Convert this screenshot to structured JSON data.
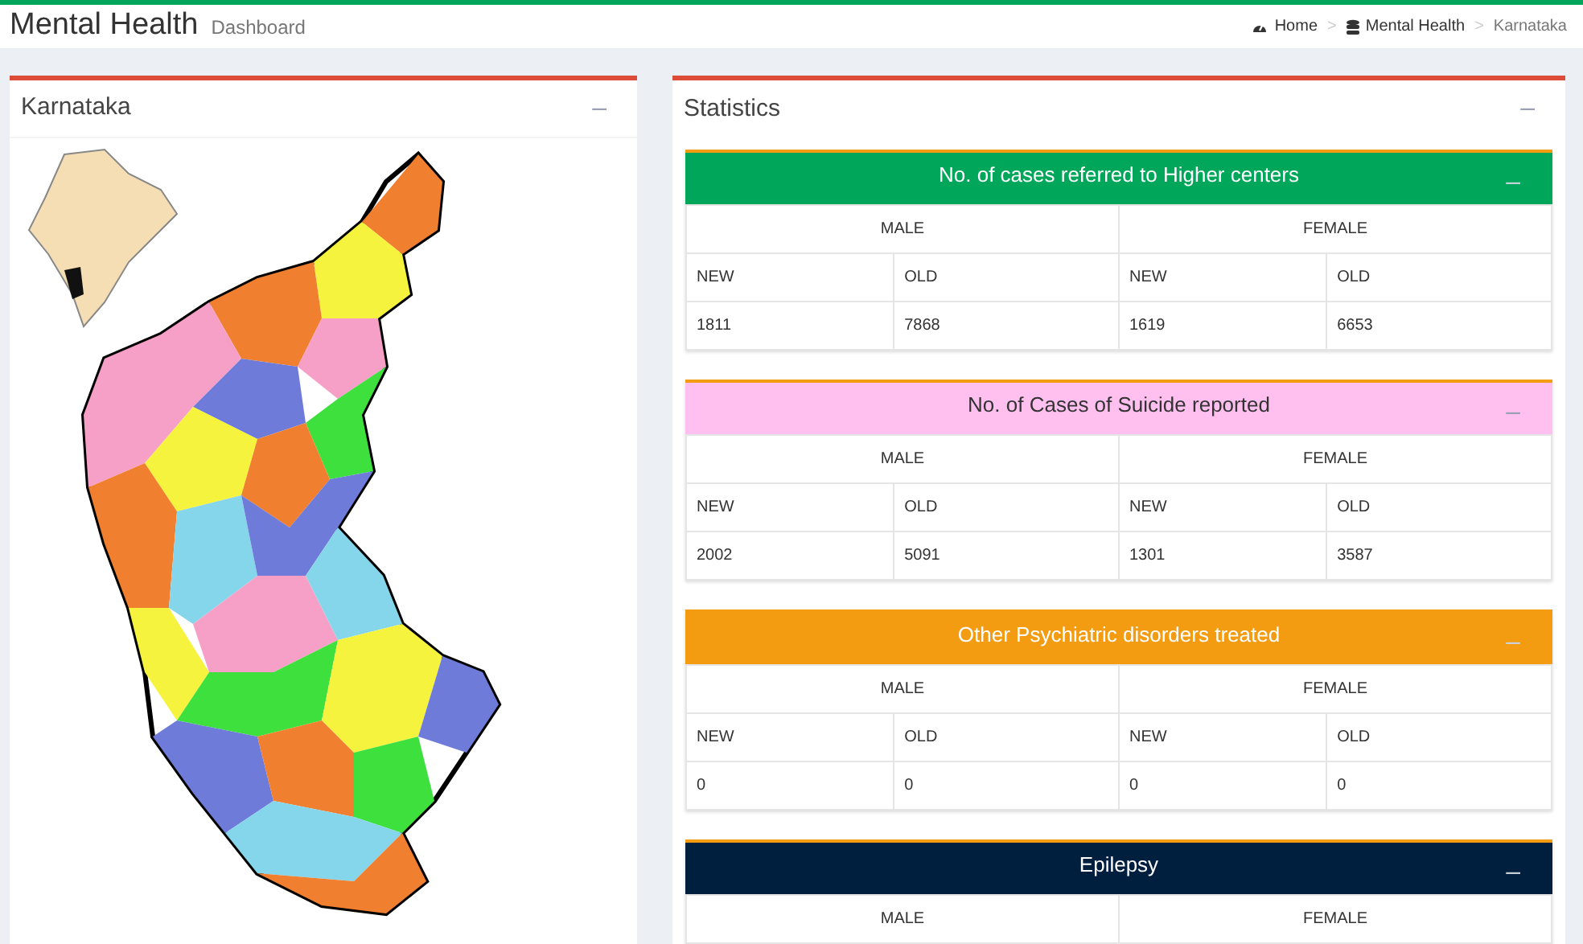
{
  "header": {
    "title": "Mental Health",
    "subtitle": "Dashboard"
  },
  "breadcrumb": [
    {
      "label": "Home",
      "kind": "dashboard"
    },
    {
      "label": "Mental Health",
      "kind": "database",
      "separator": ">"
    },
    {
      "label": "Karnataka",
      "kind": "current",
      "separator": ">"
    }
  ],
  "map_panel": {
    "title": "Karnataka",
    "collapse": "–"
  },
  "stats_panel": {
    "title": "Statistics",
    "collapse": "–",
    "cards": [
      {
        "title": "No. of cases referred to Higher centers",
        "color": "#00a65a",
        "collapse": "–",
        "groups": [
          "MALE",
          "FEMALE"
        ],
        "columns": [
          "NEW",
          "OLD",
          "NEW",
          "OLD"
        ],
        "values": [
          "1811",
          "7868",
          "1619",
          "6653"
        ]
      },
      {
        "title": "No. of Cases of Suicide reported",
        "color": "#ffc0f0",
        "collapse": "–",
        "groups": [
          "MALE",
          "FEMALE"
        ],
        "columns": [
          "NEW",
          "OLD",
          "NEW",
          "OLD"
        ],
        "values": [
          "2002",
          "5091",
          "1301",
          "3587"
        ]
      },
      {
        "title": "Other Psychiatric disorders treated",
        "color": "#f39c12",
        "collapse": "–",
        "groups": [
          "MALE",
          "FEMALE"
        ],
        "columns": [
          "NEW",
          "OLD",
          "NEW",
          "OLD"
        ],
        "values": [
          "0",
          "0",
          "0",
          "0"
        ]
      },
      {
        "title": "Epilepsy",
        "color": "#001f3f",
        "collapse": "–",
        "groups": [
          "MALE",
          "FEMALE"
        ]
      }
    ]
  }
}
